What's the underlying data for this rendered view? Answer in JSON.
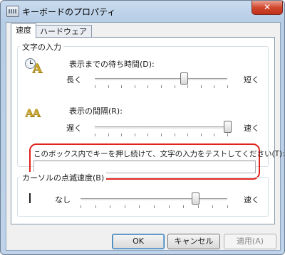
{
  "window": {
    "title": "キーボードのプロパティ",
    "close_glyph": "✕"
  },
  "tabs": [
    {
      "label": "速度",
      "active": true
    },
    {
      "label": "ハードウェア",
      "active": false
    }
  ],
  "char_input": {
    "legend": "文字の入力",
    "repeat_delay": {
      "label": "表示までの待ち時間(D):",
      "min_label": "長く",
      "max_label": "短く",
      "value_fraction": 0.67
    },
    "repeat_rate": {
      "label": "表示の間隔(R):",
      "min_label": "遅く",
      "max_label": "速く",
      "value_fraction": 1.0
    },
    "test_label": "このボックス内でキーを押し続けて、文字の入力をテストしてください(T):",
    "test_value": ""
  },
  "cursor_blink": {
    "legend": "カーソルの点滅速度(B)",
    "min_label": "なし",
    "max_label": "速く",
    "value_fraction": 0.78
  },
  "buttons": {
    "ok": "OK",
    "cancel": "キャンセル",
    "apply": "適用(A)"
  },
  "colors": {
    "highlight": "#e0231c"
  },
  "icons": {
    "repeat_delay": "clock-letter-icon",
    "repeat_rate": "double-letter-icon",
    "cursor": "text-cursor-icon"
  }
}
